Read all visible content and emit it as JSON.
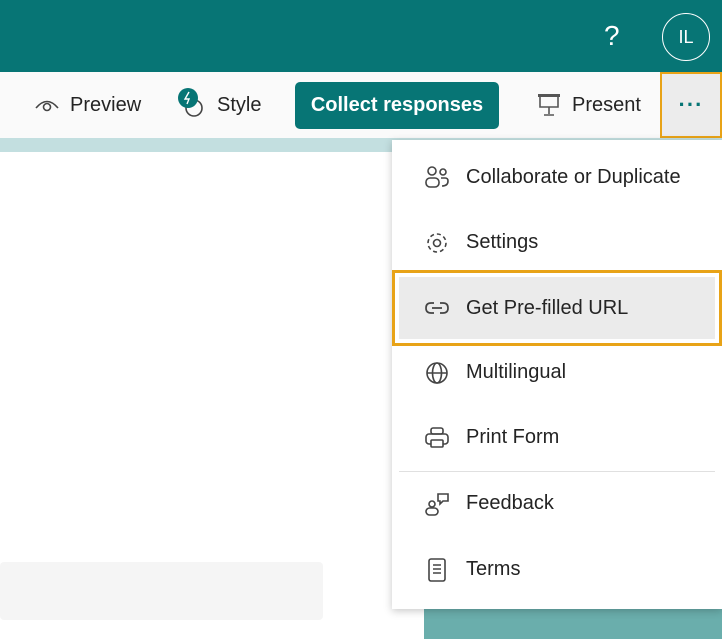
{
  "header": {
    "help_label": "?",
    "avatar_initials": "IL"
  },
  "toolbar": {
    "preview": "Preview",
    "style": "Style",
    "collect": "Collect responses",
    "present": "Present",
    "more": "···"
  },
  "menu": {
    "items": [
      {
        "label": "Collaborate or Duplicate",
        "icon": "people-icon"
      },
      {
        "label": "Settings",
        "icon": "gear-icon"
      },
      {
        "label": "Get Pre-filled URL",
        "icon": "link-icon"
      },
      {
        "label": "Multilingual",
        "icon": "globe-icon"
      },
      {
        "label": "Print Form",
        "icon": "printer-icon"
      },
      {
        "label": "Feedback",
        "icon": "feedback-icon"
      },
      {
        "label": "Terms",
        "icon": "document-icon"
      }
    ]
  },
  "colors": {
    "brand": "#077575",
    "highlight_border": "#e8a317"
  }
}
